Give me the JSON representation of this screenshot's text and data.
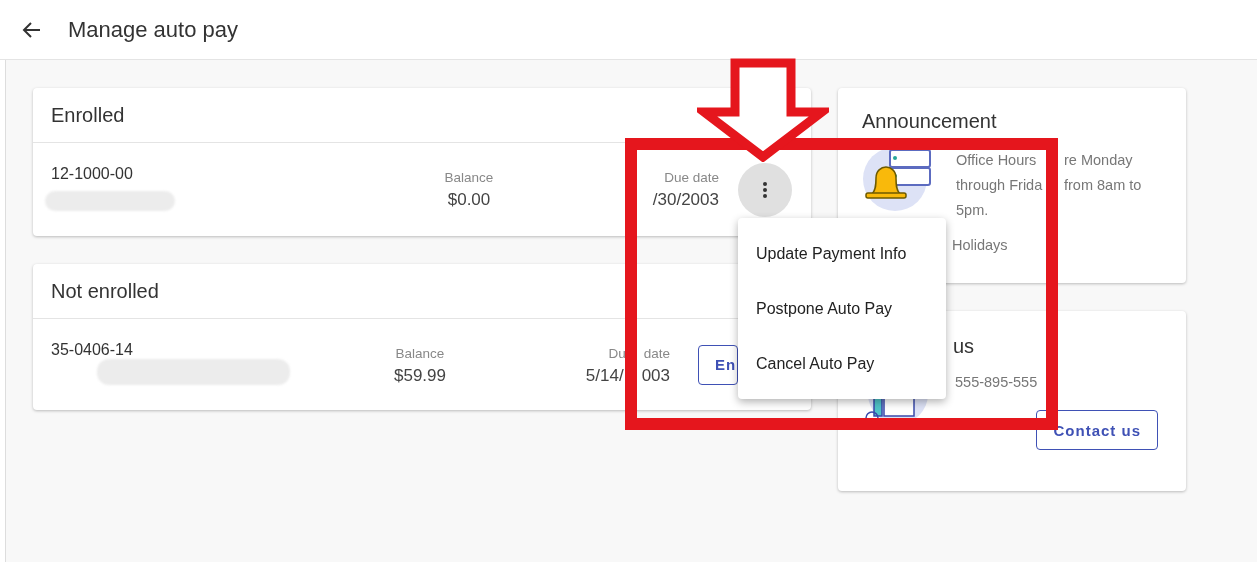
{
  "header": {
    "title": "Manage auto pay"
  },
  "sections": [
    {
      "title": "Enrolled",
      "accounts": [
        {
          "number": "12-1000-00",
          "balance_label": "Balance",
          "balance": "$0.00",
          "due_label_parts": [
            "Due date"
          ],
          "due_value_parts": [
            "/30/2003"
          ],
          "action": {
            "kind": "menu"
          }
        }
      ]
    },
    {
      "title": "Not enrolled",
      "accounts": [
        {
          "number": "35-0406-14",
          "balance_label": "Balance",
          "balance": "$59.99",
          "due_label_parts": [
            "Du",
            "date"
          ],
          "due_value_parts": [
            "5/14/",
            "003"
          ],
          "action": {
            "kind": "button",
            "label": "En"
          }
        }
      ]
    }
  ],
  "menu": {
    "items": [
      {
        "label": "Update Payment Info"
      },
      {
        "label": "Postpone Auto Pay"
      },
      {
        "label": "Cancel Auto Pay"
      }
    ]
  },
  "announcement": {
    "title": "Announcement",
    "lines": [
      [
        "Office Hours",
        "re Monday"
      ],
      [
        "through Frida",
        "from 8am to"
      ],
      [
        "5pm."
      ]
    ],
    "note": "Holidays"
  },
  "contact": {
    "title": "us",
    "phone": "555-895-555",
    "button": "Contact us"
  }
}
